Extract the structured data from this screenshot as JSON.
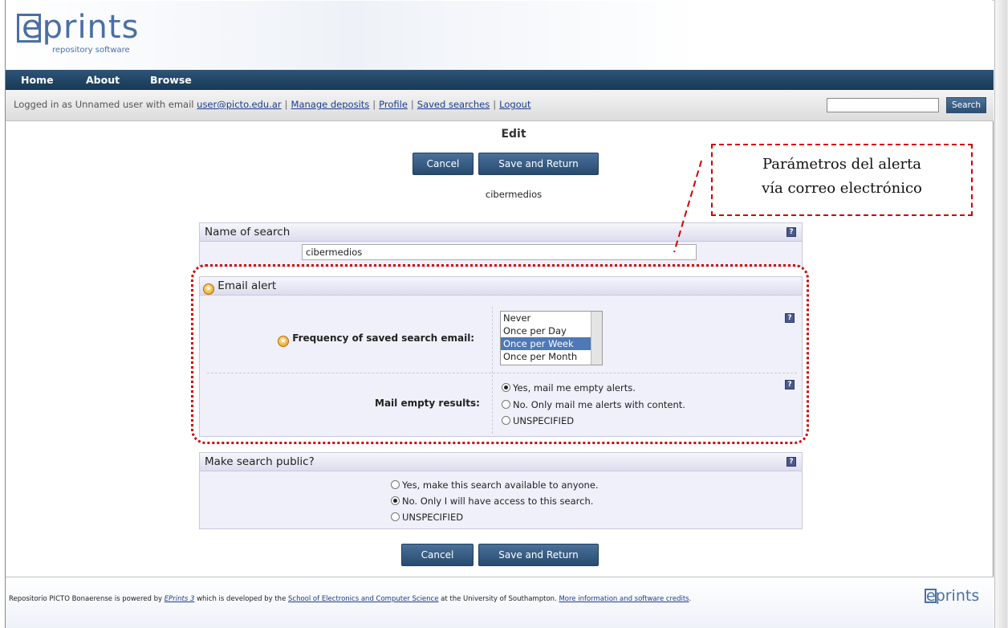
{
  "brand": {
    "logo_text": "eprints",
    "logo_sub": "repository software"
  },
  "nav": {
    "items": [
      "Home",
      "About",
      "Browse"
    ]
  },
  "userbar": {
    "prefix": "Logged in as Unnamed user with email",
    "email": "user@picto.edu.ar",
    "links": [
      "Manage deposits",
      "Profile",
      "Saved searches",
      "Logout"
    ],
    "search_button": "Search",
    "search_value": ""
  },
  "page": {
    "title": "Edit",
    "cancel_label": "Cancel",
    "save_label": "Save and Return",
    "record_name": "cibermedios"
  },
  "name_panel": {
    "header": "Name of search",
    "value": "cibermedios",
    "help": "?"
  },
  "email_panel": {
    "header": "Email alert",
    "frequency_label": "Frequency of saved search email:",
    "frequency_options": [
      "Never",
      "Once per Day",
      "Once per Week",
      "Once per Month"
    ],
    "frequency_selected": "Once per Week",
    "mail_empty_label": "Mail empty results:",
    "mail_empty_options": [
      "Yes, mail me empty alerts.",
      "No. Only mail me alerts with content.",
      "UNSPECIFIED"
    ],
    "mail_empty_selected": "Yes, mail me empty alerts."
  },
  "public_panel": {
    "header": "Make search public?",
    "options": [
      "Yes, make this search available to anyone.",
      "No. Only I will have access to this search.",
      "UNSPECIFIED"
    ],
    "selected": "No. Only I will have access to this search."
  },
  "annotation": {
    "line1": "Parámetros del alerta",
    "line2": "vía correo electrónico",
    "color": "#d20000"
  },
  "footer": {
    "text1": "Repositorio PICTO Bonaerense is powered by",
    "link1": "EPrints 3",
    "text2": "which is developed by the",
    "link2": "School of Electronics and Computer Science",
    "text3": "at the University of Southampton.",
    "link3": "More information and software credits",
    "text4": ".",
    "logo": "eprints"
  },
  "colors": {
    "nav_bg": "#173956",
    "button_bg": "#274b70",
    "panel_bg": "#f0f0fb",
    "link": "#1d3c8e"
  }
}
